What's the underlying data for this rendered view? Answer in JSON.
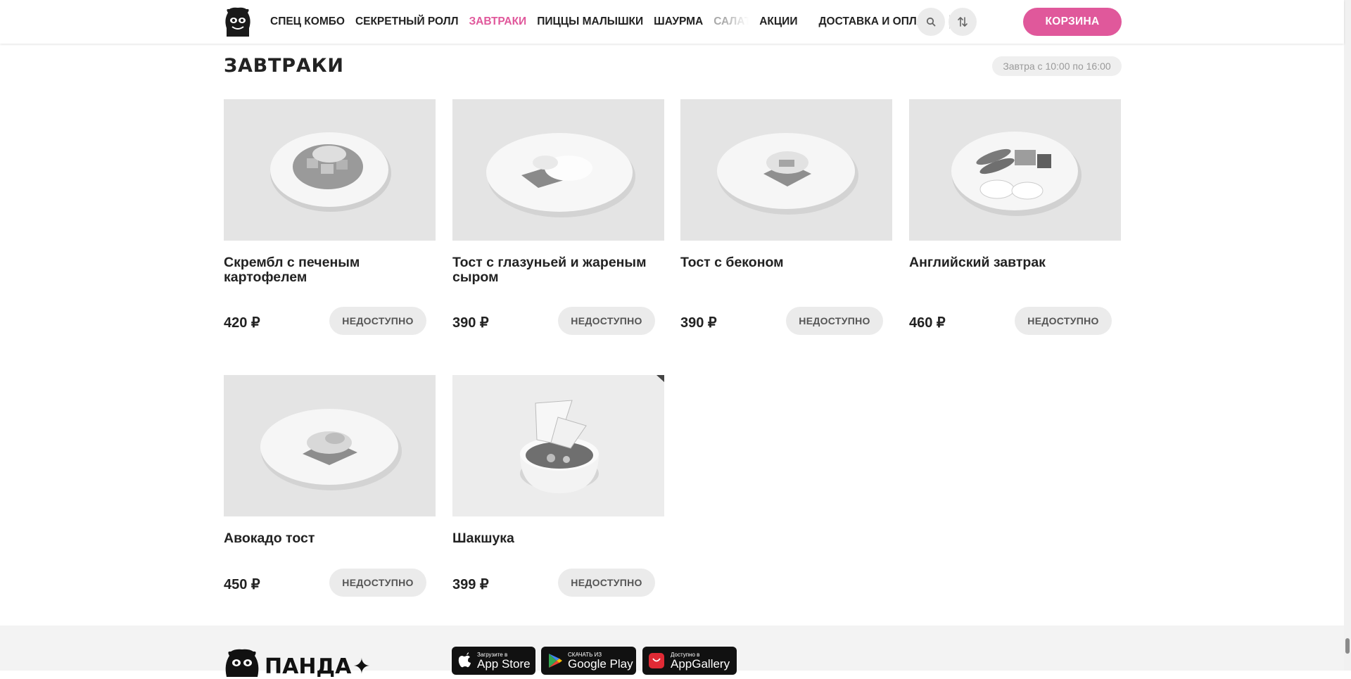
{
  "header": {
    "nav": [
      {
        "label": "СПЕЦ КОМБО"
      },
      {
        "label": "СЕКРЕТНЫЙ РОЛЛ"
      },
      {
        "label": "ЗАВТРАКИ"
      },
      {
        "label": "ПИЦЦЫ МАЛЫШКИ"
      },
      {
        "label": "ШАУРМА"
      },
      {
        "label": "САЛАТЫ"
      },
      {
        "label": "АКЦИИ"
      },
      {
        "label": "ДОСТАВКА И ОПЛАТА"
      }
    ],
    "active_index": 2,
    "search_icon": "search-icon",
    "sort_icon": "sort-arrows-icon",
    "cart_label": "КОРЗИНА",
    "accent_color": "#e0589b"
  },
  "section": {
    "title": "ЗАВТРАКИ",
    "hours_badge": "Завтра с 10:00 по 16:00"
  },
  "products": [
    {
      "name": "Скрембл с печеным картофелем",
      "price": "420 ₽",
      "button": "НЕДОСТУПНО"
    },
    {
      "name": "Тост с глазуньей и жареным сыром",
      "price": "390 ₽",
      "button": "НЕДОСТУПНО"
    },
    {
      "name": "Тост с беконом",
      "price": "390 ₽",
      "button": "НЕДОСТУПНО"
    },
    {
      "name": "Английский завтрак",
      "price": "460 ₽",
      "button": "НЕДОСТУПНО"
    },
    {
      "name": "Авокадо тост",
      "price": "450 ₽",
      "button": "НЕДОСТУПНО"
    },
    {
      "name": "Шакшука",
      "price": "399 ₽",
      "button": "НЕДОСТУПНО"
    }
  ],
  "footer": {
    "brand": "ПАНДА",
    "stores": [
      {
        "small": "Загрузите в",
        "big": "App Store",
        "icon": "apple-icon"
      },
      {
        "small": "СКАЧАТЬ ИЗ",
        "big": "Google Play",
        "icon": "google-play-icon"
      },
      {
        "small": "Доступно в",
        "big": "AppGallery",
        "icon": "huawei-icon"
      }
    ]
  }
}
